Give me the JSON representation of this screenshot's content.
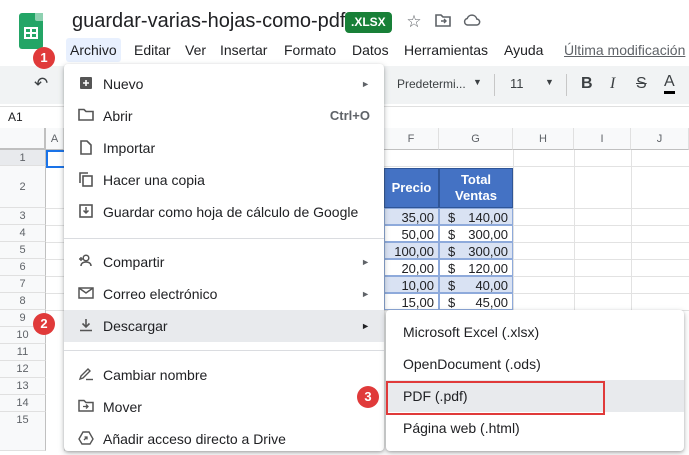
{
  "doc": {
    "title": "guardar-varias-hojas-como-pdf",
    "badge": ".XLSX"
  },
  "menubar": {
    "items": [
      "Archivo",
      "Editar",
      "Ver",
      "Insertar",
      "Formato",
      "Datos",
      "Herramientas",
      "Ayuda"
    ],
    "last_edit": "Última modificación"
  },
  "toolbar": {
    "font": "Predetermi...",
    "font_size": "11",
    "bold": "B",
    "italic": "I",
    "strike": "S",
    "text_color": "A"
  },
  "namebox": "A1",
  "columns": [
    "A",
    "F",
    "G",
    "H",
    "I",
    "J"
  ],
  "rows": [
    "1",
    "2",
    "3",
    "4",
    "5",
    "6",
    "7",
    "8",
    "9",
    "10",
    "11",
    "12",
    "13",
    "14",
    "15"
  ],
  "table": {
    "headers": [
      "Precio",
      "Total Ventas"
    ],
    "precio": [
      "35,00",
      "50,00",
      "100,00",
      "20,00",
      "10,00",
      "15,00"
    ],
    "currency": "$",
    "total": [
      "140,00",
      "300,00",
      "300,00",
      "120,00",
      "40,00",
      "45,00"
    ]
  },
  "archivo_menu": {
    "items": [
      {
        "label": "Nuevo",
        "icon": "table-plus-icon",
        "arrow": "►"
      },
      {
        "label": "Abrir",
        "icon": "folder-icon",
        "shortcut": "Ctrl+O"
      },
      {
        "label": "Importar",
        "icon": "file-icon"
      },
      {
        "label": "Hacer una copia",
        "icon": "copy-icon"
      },
      {
        "label": "Guardar como hoja de cálculo de Google",
        "icon": "save-to-drive-icon"
      },
      {
        "label": "Compartir",
        "icon": "person-add-icon",
        "arrow": "►"
      },
      {
        "label": "Correo electrónico",
        "icon": "mail-icon",
        "arrow": "►"
      },
      {
        "label": "Descargar",
        "icon": "download-icon",
        "arrow": "►"
      },
      {
        "label": "Cambiar nombre",
        "icon": "rename-icon"
      },
      {
        "label": "Mover",
        "icon": "move-folder-icon"
      },
      {
        "label": "Añadir acceso directo a Drive",
        "icon": "drive-shortcut-icon"
      }
    ]
  },
  "download_submenu": {
    "items": [
      "Microsoft Excel (.xlsx)",
      "OpenDocument (.ods)",
      "PDF (.pdf)",
      "Página web (.html)"
    ]
  },
  "callouts": [
    "1",
    "2",
    "3"
  ],
  "colors": {
    "accent_red": "#e03a3a",
    "header_blue": "#4472c4",
    "sheets_green": "#23a566"
  }
}
